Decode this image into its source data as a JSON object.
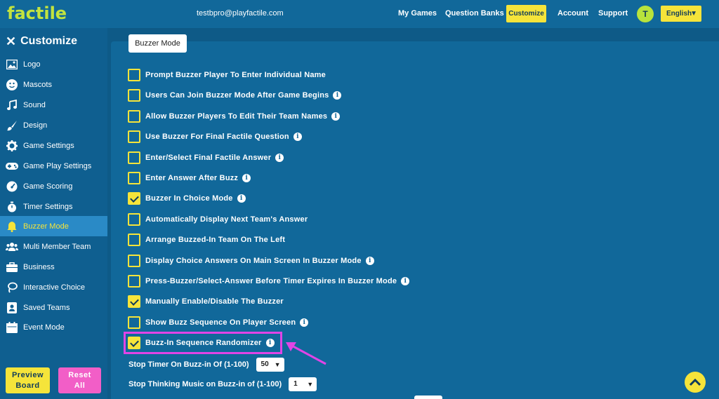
{
  "header": {
    "logo": "factile",
    "email": "testbpro@playfactile.com",
    "nav": [
      "My Games",
      "Question Banks",
      "Customize",
      "Account",
      "Support"
    ],
    "avatar_initial": "T",
    "language": "English"
  },
  "sidebar": {
    "title": "Customize",
    "items": [
      {
        "label": "Logo",
        "icon": "image-icon"
      },
      {
        "label": "Mascots",
        "icon": "smiley-icon"
      },
      {
        "label": "Sound",
        "icon": "music-note-icon"
      },
      {
        "label": "Design",
        "icon": "paintbrush-icon"
      },
      {
        "label": "Game Settings",
        "icon": "gear-icon"
      },
      {
        "label": "Game Play Settings",
        "icon": "gamepad-icon"
      },
      {
        "label": "Game Scoring",
        "icon": "gauge-icon"
      },
      {
        "label": "Timer Settings",
        "icon": "stopwatch-icon"
      },
      {
        "label": "Buzzer Mode",
        "icon": "bell-icon",
        "active": true
      },
      {
        "label": "Multi Member Team",
        "icon": "users-icon"
      },
      {
        "label": "Business",
        "icon": "briefcase-icon"
      },
      {
        "label": "Interactive Choice",
        "icon": "lasso-icon"
      },
      {
        "label": "Saved Teams",
        "icon": "id-badge-icon"
      },
      {
        "label": "Event Mode",
        "icon": "calendar-icon"
      }
    ],
    "preview_line1": "Preview",
    "preview_line2": "Board",
    "reset_line1": "Reset",
    "reset_line2": "All"
  },
  "main": {
    "tab": "Buzzer Mode",
    "options": [
      {
        "label": "Prompt Buzzer Player To Enter Individual Name",
        "checked": false,
        "info": false
      },
      {
        "label": "Users Can Join Buzzer Mode After Game Begins",
        "checked": false,
        "info": true
      },
      {
        "label": "Allow Buzzer Players To Edit Their Team Names",
        "checked": false,
        "info": true
      },
      {
        "label": "Use Buzzer For Final Factile Question",
        "checked": false,
        "info": true
      },
      {
        "label": "Enter/Select Final Factile Answer",
        "checked": false,
        "info": true
      },
      {
        "label": "Enter Answer After Buzz",
        "checked": false,
        "info": true
      },
      {
        "label": "Buzzer In Choice Mode",
        "checked": true,
        "info": true
      },
      {
        "label": "Automatically Display Next Team's Answer",
        "checked": false,
        "info": false
      },
      {
        "label": "Arrange Buzzed-In Team On The Left",
        "checked": false,
        "info": false
      },
      {
        "label": "Display Choice Answers On Main Screen In Buzzer Mode",
        "checked": false,
        "info": true
      },
      {
        "label": "Press-Buzzer/Select-Answer Before Timer Expires In Buzzer Mode",
        "checked": false,
        "info": true
      },
      {
        "label": "Manually Enable/Disable The Buzzer",
        "checked": true,
        "info": false
      },
      {
        "label": "Show Buzz Sequence On Player Screen",
        "checked": false,
        "info": true
      },
      {
        "label": "Buzz-In Sequence Randomizer",
        "checked": true,
        "info": true
      }
    ],
    "stop_timer_label": "Stop Timer On Buzz-in Of (1-100)",
    "stop_timer_value": "50",
    "stop_music_label": "Stop Thinking Music on Buzz-in of (1-100)",
    "stop_music_value": "1"
  },
  "colors": {
    "accent": "#f5e43a",
    "highlight": "#e044e6",
    "background": "#0e5a87"
  }
}
